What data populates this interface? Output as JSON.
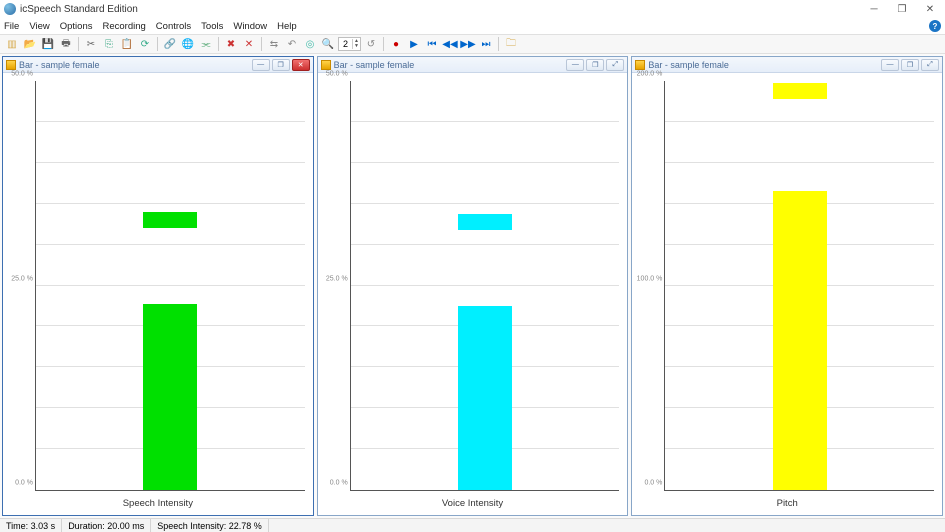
{
  "window": {
    "title": "icSpeech Standard Edition"
  },
  "menu": [
    "File",
    "View",
    "Options",
    "Recording",
    "Controls",
    "Tools",
    "Window",
    "Help"
  ],
  "toolbar": {
    "spin_value": "2"
  },
  "panels": [
    {
      "title": "Bar - sample female",
      "active": true,
      "xlabel": "Speech Intensity"
    },
    {
      "title": "Bar - sample female",
      "active": false,
      "xlabel": "Voice Intensity"
    },
    {
      "title": "Bar - sample female",
      "active": false,
      "xlabel": "Pitch"
    }
  ],
  "chart_data": [
    {
      "type": "bar",
      "title": "",
      "xlabel": "Speech Intensity",
      "ylabel": "",
      "ylim": [
        0,
        50
      ],
      "y_ticks": [
        0,
        25,
        50
      ],
      "y_tick_labels": [
        "0.0 %",
        "25.0 %",
        "50.0 %"
      ],
      "gridlines": 10,
      "bar_value": 22.8,
      "marker_value": 33.0,
      "bar_color": "#00E000",
      "marker_color": "#00E000"
    },
    {
      "type": "bar",
      "title": "",
      "xlabel": "Voice Intensity",
      "ylabel": "",
      "ylim": [
        0,
        50
      ],
      "y_ticks": [
        0,
        25,
        50
      ],
      "y_tick_labels": [
        "0.0 %",
        "25.0 %",
        "50.0 %"
      ],
      "gridlines": 10,
      "bar_value": 22.5,
      "marker_value": 32.8,
      "bar_color": "#00EFFF",
      "marker_color": "#00EFFF"
    },
    {
      "type": "bar",
      "title": "",
      "xlabel": "Pitch",
      "ylabel": "",
      "ylim": [
        0,
        200
      ],
      "y_ticks": [
        0,
        100,
        200
      ],
      "y_tick_labels": [
        "0.0 %",
        "100.0 %",
        "200.0 %"
      ],
      "gridlines": 10,
      "bar_value": 146.0,
      "marker_value": 195.0,
      "bar_color": "#FFFF00",
      "marker_color": "#FFFF00"
    }
  ],
  "status": {
    "time": "Time: 3.03 s",
    "duration": "Duration: 20.00 ms",
    "intensity": "Speech Intensity: 22.78 %"
  }
}
